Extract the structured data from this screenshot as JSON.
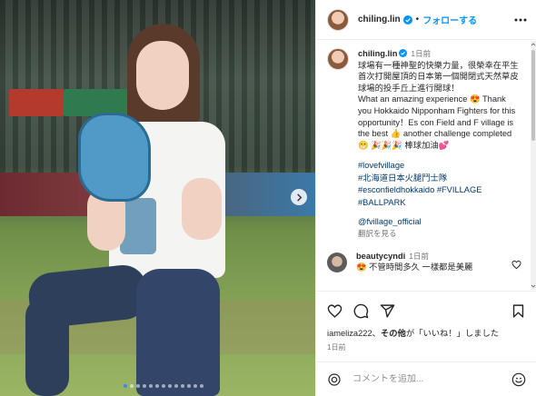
{
  "post": {
    "username": "chiling.lin",
    "follow_label": "フォローする",
    "separator": "•",
    "caption": {
      "username": "chiling.lin",
      "time": "1日前",
      "text": "球場有一種神聖的快樂力量，很榮幸在平生首次打開屋頂的日本第一個開閉式天然草皮球場的投手丘上進行開球！\nWhat an amazing experience 😍 Thank you Hokkaido Nipponham Fighters for this opportunity！Es con Field and F village is the best 👍 another challenge completed 😁 🎉🎉🎉 棒球加油💕",
      "hashtags": [
        "#lovefvillage",
        "#北海道日本火腿鬥士隊",
        "#esconfieldhokkaido #FVILLAGE",
        "#BALLPARK"
      ],
      "mention": "@fvillage_official",
      "translate_label": "翻訳を見る"
    },
    "comment": {
      "username": "beautycyndi",
      "time": "1日前",
      "text": "😍 不管時間多久 一樣都是美麗"
    },
    "likes": {
      "user": "iameliza222",
      "connector": "、",
      "others": "その他",
      "suffix": "が「いいね！」しました"
    },
    "date": "1日前",
    "comment_placeholder": "コメントを追加...",
    "carousel": {
      "slides": 13,
      "active_index": 0
    },
    "accent_color": "#0095f6"
  }
}
